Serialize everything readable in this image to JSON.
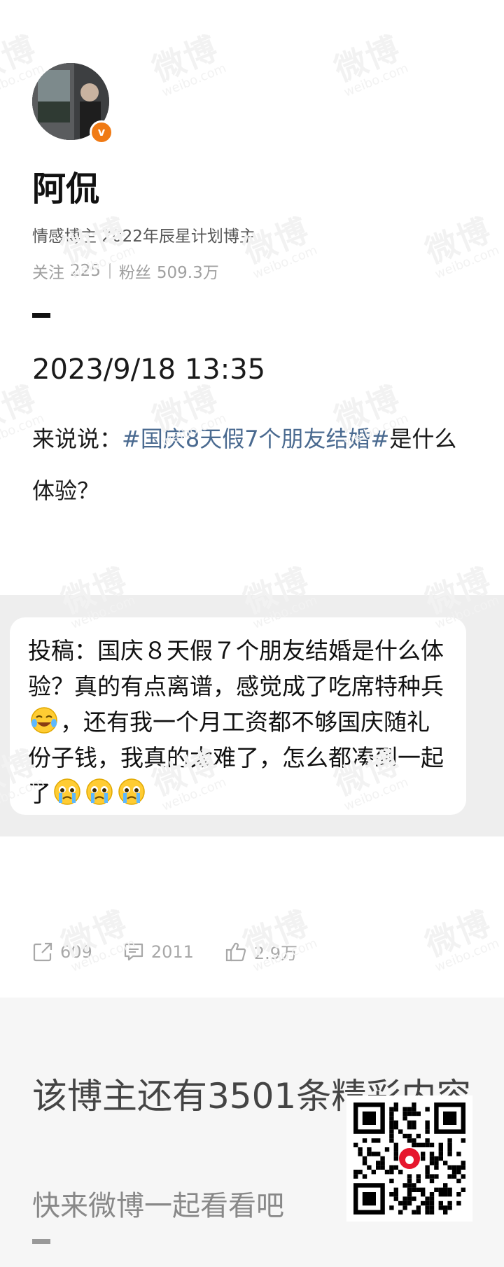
{
  "watermark": {
    "text": "微博",
    "sub": "weibo.com"
  },
  "profile": {
    "name": "阿侃",
    "description": "情感博主 2022年辰星计划博主",
    "following_label": "关注",
    "following_count": "225",
    "followers_label": "粉丝",
    "followers_count": "509.3万",
    "verified_icon": "verified-badge-icon",
    "verified_mark": "v"
  },
  "post": {
    "timestamp": "2023/9/18 13:35",
    "text_prefix": "来说说：",
    "hashtag": "#国庆8天假7个朋友结婚#",
    "text_suffix": "是什么体验？"
  },
  "submission": {
    "part1": "投稿：国庆８天假７个朋友结婚是什么体验？真的有点离谱，感觉成了吃席特种兵",
    "part2": "，还有我一个月工资都不够国庆随礼份子钱，我真的太难了，怎么都凑到一起了",
    "emojis": [
      "laugh-cry-emoji",
      "teary-emoji",
      "teary-emoji",
      "teary-emoji"
    ]
  },
  "actions": {
    "repost": {
      "icon": "share-icon",
      "count": "609"
    },
    "comment": {
      "icon": "comment-icon",
      "count": "2011"
    },
    "like": {
      "icon": "thumbs-up-icon",
      "count": "2.9万"
    }
  },
  "footer": {
    "title": "该博主还有3501条精彩内容",
    "subtitle": "快来微博一起看看吧",
    "qr_icon": "weibo-qr-code"
  },
  "colors": {
    "hashtag": "#4a6a90",
    "verified": "#f07a14",
    "muted": "#a8a8a8",
    "band": "#eeeeee"
  }
}
